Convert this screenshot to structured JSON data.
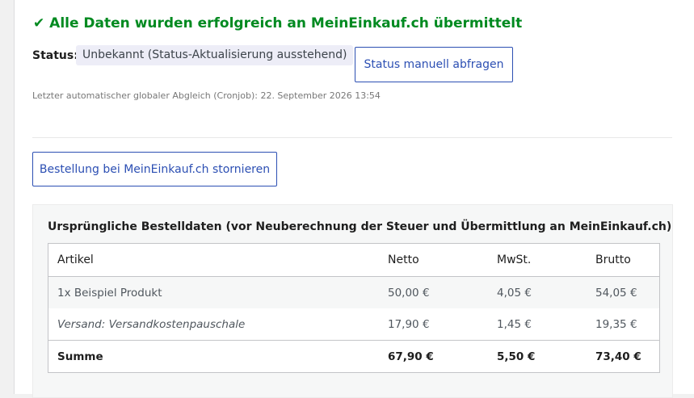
{
  "success": {
    "check": "✔",
    "message": "Alle Daten wurden erfolgreich an MeinEinkauf.ch übermittelt"
  },
  "status": {
    "label": "Status:",
    "value": "Unbekannt (Status-Aktualisierung ausstehend)",
    "query_button": "Status manuell abfragen"
  },
  "cron_note": "Letzter automatischer globaler Abgleich (Cronjob): 22. September 2026 13:54",
  "cancel_button": "Bestellung bei MeinEinkauf.ch stornieren",
  "original_order": {
    "title": "Ursprüngliche Bestelldaten (vor Neuberechnung der Steuer und Übermittlung an MeinEinkauf.ch)",
    "columns": [
      "Artikel",
      "Netto",
      "MwSt.",
      "Brutto"
    ],
    "rows": [
      {
        "article": "1x Beispiel Produkt",
        "net": "50,00 €",
        "vat": "4,05 €",
        "gross": "54,05 €"
      },
      {
        "article": "Versand: Versandkostenpauschale",
        "net": "17,90 €",
        "vat": "1,45 €",
        "gross": "19,35 €"
      }
    ],
    "total": {
      "label": "Summe",
      "net": "67,90 €",
      "vat": "5,50 €",
      "gross": "73,40 €"
    }
  },
  "colors": {
    "success": "#008a20",
    "accent": "#2c4fb3",
    "badge_bg": "#ededf7"
  }
}
